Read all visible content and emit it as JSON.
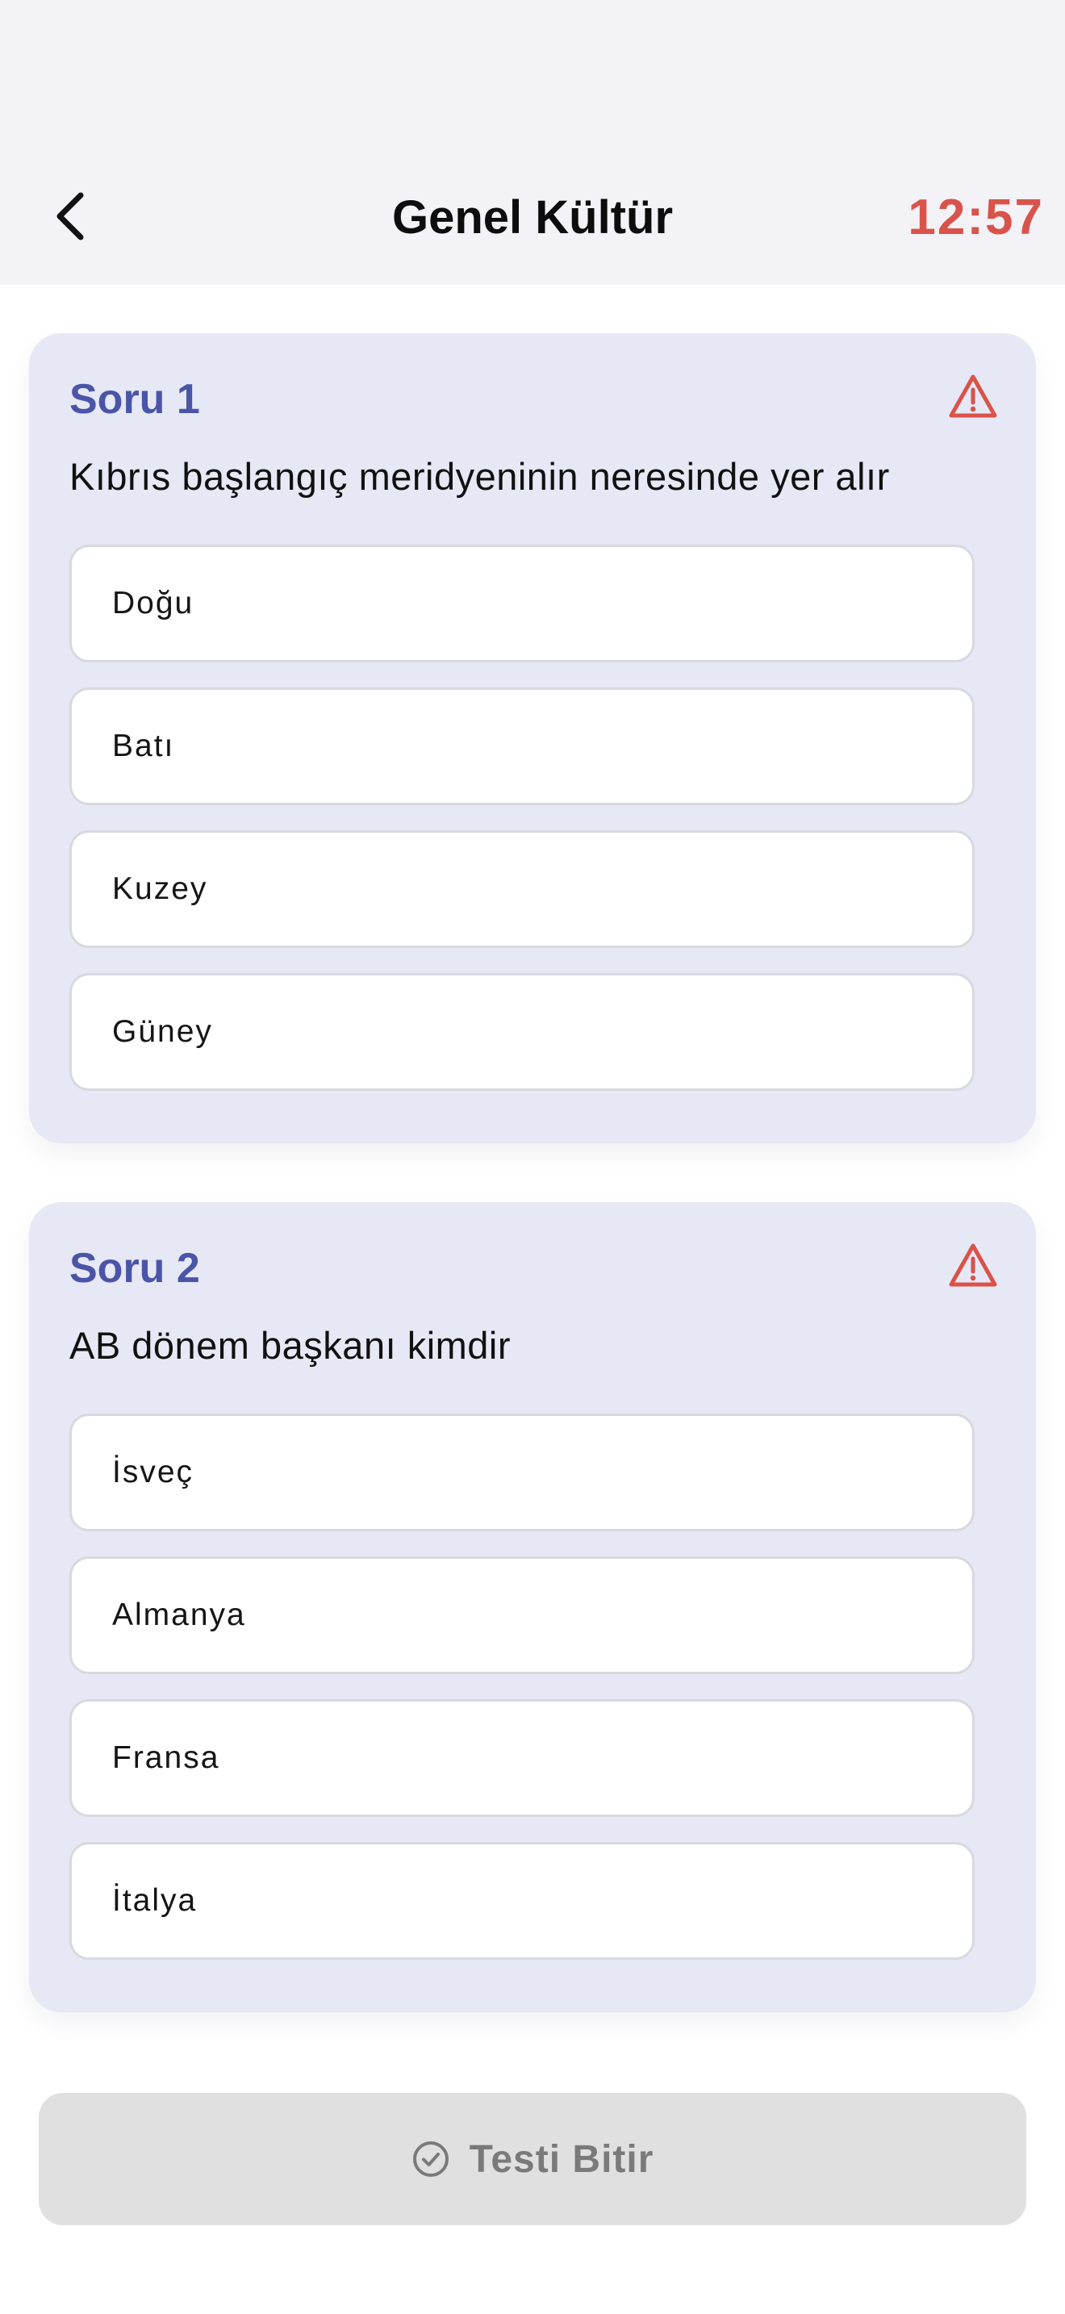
{
  "header": {
    "title": "Genel Kültür",
    "timer": "12:57",
    "back_icon": "chevron-left-icon"
  },
  "colors": {
    "accent": "#4a55a8",
    "timer": "#d9534a",
    "card_background": "#e6e8f5",
    "warning": "#d9534a"
  },
  "questions": [
    {
      "label": "Soru 1",
      "text": "Kıbrıs başlangıç meridyeninin neresinde yer alır",
      "report_icon": "warning-triangle-icon",
      "options": [
        "Doğu",
        "Batı",
        "Kuzey",
        "Güney"
      ]
    },
    {
      "label": "Soru 2",
      "text": "AB dönem başkanı kimdir",
      "report_icon": "warning-triangle-icon",
      "options": [
        "İsveç",
        "Almanya",
        "Fransa",
        "İtalya"
      ]
    }
  ],
  "footer": {
    "finish_label": "Testi Bitir",
    "finish_icon": "check-circle-icon"
  }
}
